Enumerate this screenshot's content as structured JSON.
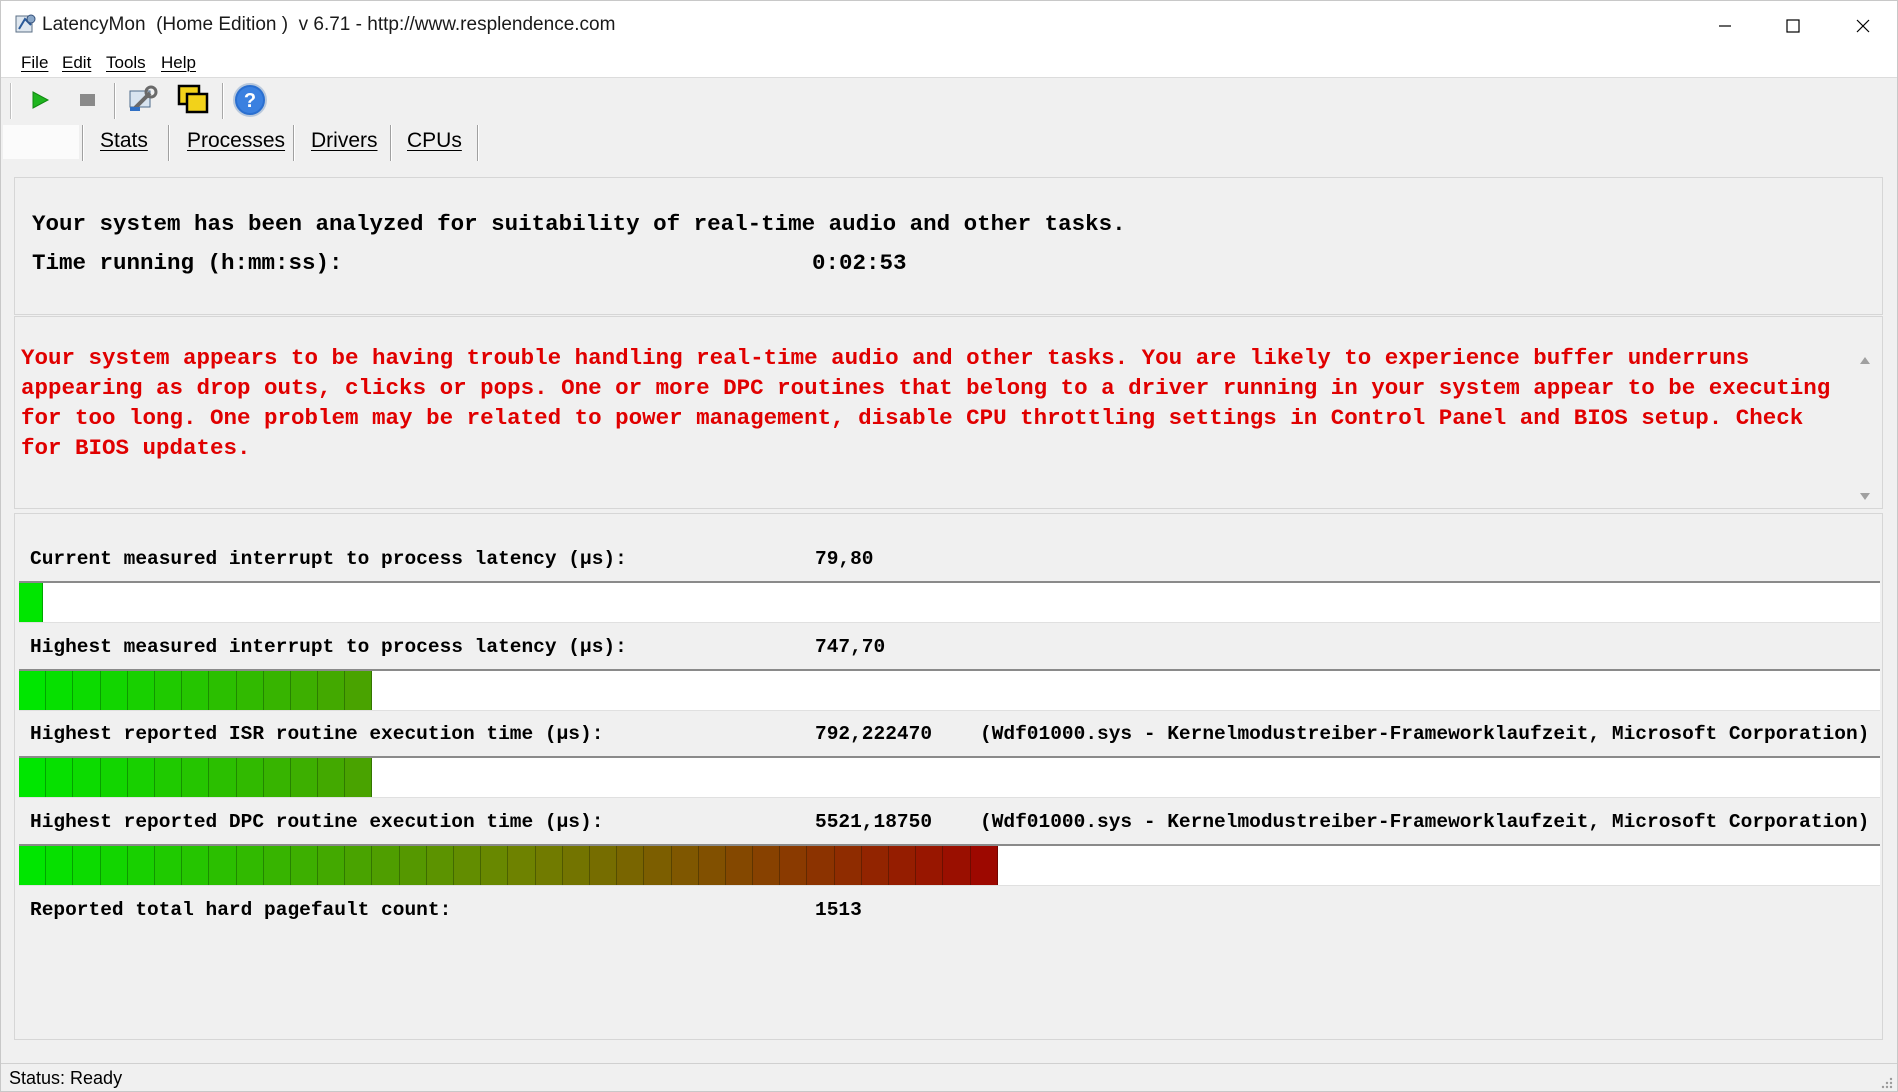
{
  "window": {
    "title": "LatencyMon  (Home Edition )  v 6.71 - http://www.resplendence.com"
  },
  "menu": {
    "file": "File",
    "edit": "Edit",
    "tools": "Tools",
    "help": "Help"
  },
  "toolbar": {
    "icons": [
      "play-icon",
      "stop-icon",
      "wrench-icon",
      "copy-windows-icon",
      "help-icon"
    ]
  },
  "tabs": {
    "stats": "Stats",
    "processes": "Processes",
    "drivers": "Drivers",
    "cpus": "CPUs"
  },
  "summary": {
    "analysis_text": "Your system has been analyzed for suitability of real-time audio and other tasks.",
    "time_label": "Time running (h:mm:ss):",
    "time_value": "0:02:53"
  },
  "warning": {
    "text": "Your system appears to be having trouble handling real-time audio and other tasks. You are likely to experience buffer underruns appearing as drop outs, clicks or pops. One or more DPC routines that belong to a driver running in your system appear to be executing for too long. One problem may be related to power management, disable CPU throttling settings in Control Panel and BIOS setup. Check for BIOS updates.",
    "color": "#e00000"
  },
  "metrics": {
    "current_latency": {
      "label": "Current measured interrupt to process latency (µs):",
      "value": "79,80",
      "bar_segments": 1
    },
    "highest_latency": {
      "label": "Highest measured interrupt to process latency (µs):",
      "value": "747,70",
      "bar_segments": 13
    },
    "isr_time": {
      "label": "Highest reported ISR routine execution time (µs):",
      "value": "792,222470",
      "source": "(Wdf01000.sys - Kernelmodustreiber-Frameworklaufzeit, Microsoft Corporation)",
      "bar_segments": 13
    },
    "dpc_time": {
      "label": "Highest reported DPC routine execution time (µs):",
      "value": "5521,18750",
      "source": "(Wdf01000.sys - Kernelmodustreiber-Frameworklaufzeit, Microsoft Corporation)",
      "bar_segments": 36
    },
    "pagefault": {
      "label": "Reported total hard pagefault count:",
      "value": "1513"
    }
  },
  "status": {
    "text": "Status: Ready"
  },
  "colors": {
    "bar_start": "#00e600",
    "bar_end": "#a00000"
  }
}
